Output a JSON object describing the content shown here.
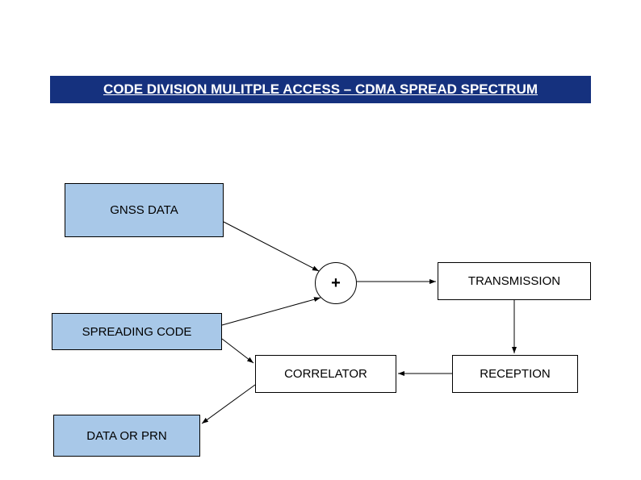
{
  "title": "CODE DIVISION MULITPLE  ACCESS – CDMA SPREAD SPECTRUM",
  "nodes": {
    "gnss": "GNSS DATA",
    "spread": "SPREADING CODE",
    "dataprn": "DATA OR PRN",
    "plus": "+",
    "transmission": "TRANSMISSION",
    "correlator": "CORRELATOR",
    "reception": "RECEPTION"
  }
}
